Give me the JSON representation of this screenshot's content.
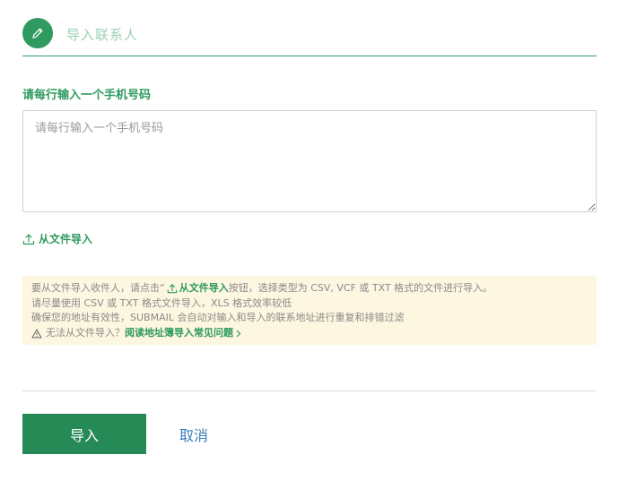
{
  "header": {
    "title": "导入联系人",
    "icon": "pencil-icon",
    "accent_color": "#2f9a60"
  },
  "phone_input": {
    "label": "请每行输入一个手机号码",
    "placeholder": "请每行输入一个手机号码",
    "value": ""
  },
  "file_import": {
    "icon": "upload-icon",
    "label": "从文件导入"
  },
  "info": {
    "line1_prefix": "要从文件导入收件人，请点击“",
    "line1_link": "从文件导入",
    "line1_suffix": "按钮，选择类型为 CSV, VCF 或 TXT 格式的文件进行导入。",
    "line2": "请尽量使用 CSV 或 TXT 格式文件导入，XLS 格式效率较低",
    "line3": "确保您的地址有效性，SUBMAIL 会自动对输入和导入的联系地址进行重复和排错过滤",
    "warning_icon": "warning-icon",
    "line4_prefix": "无法从文件导入？",
    "faq_link": "阅读地址簿导入常见问题",
    "background_color": "#fdf6e0"
  },
  "actions": {
    "import_label": "导入",
    "cancel_label": "取消",
    "import_color": "#258a56",
    "cancel_color": "#3a7bb8"
  }
}
